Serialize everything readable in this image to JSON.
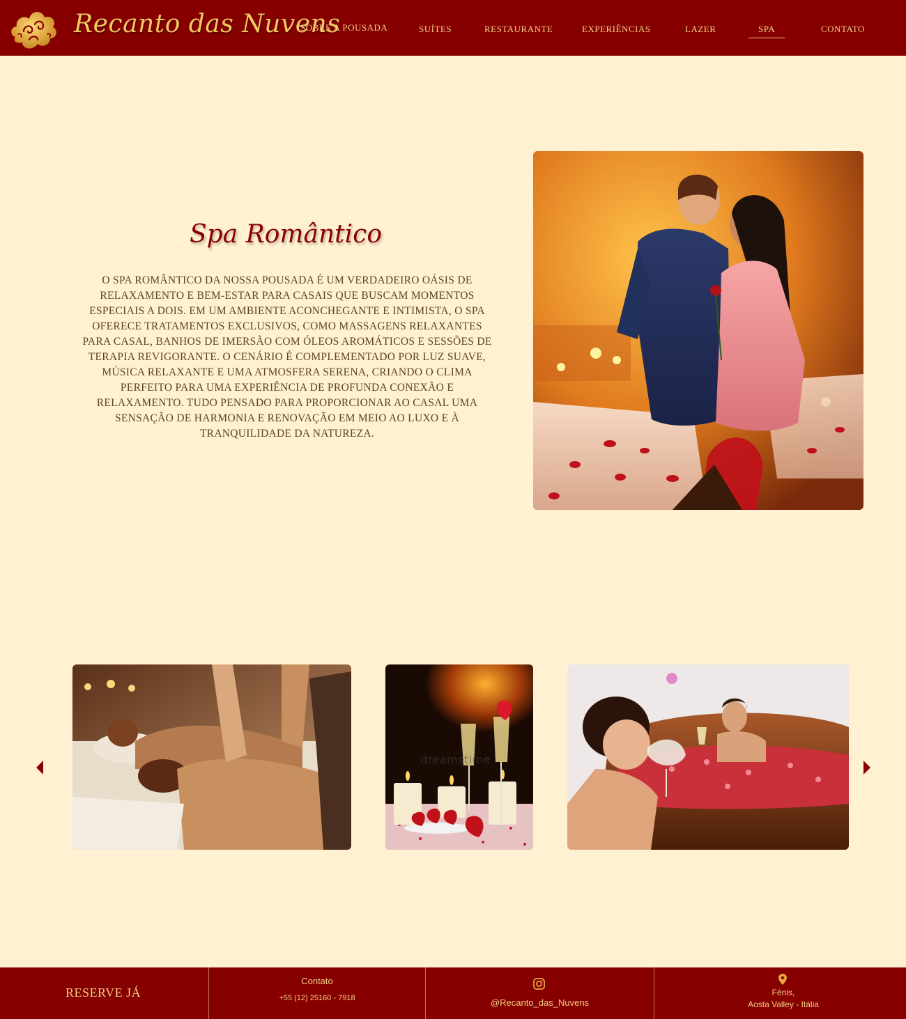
{
  "header": {
    "brand": "Recanto das Nuvens",
    "nav": [
      {
        "label": "SOBRE A POUSADA"
      },
      {
        "label": "SUÍTES"
      },
      {
        "label": "RESTAURANTE"
      },
      {
        "label": "EXPERIÊNCIAS"
      },
      {
        "label": "LAZER"
      },
      {
        "label": "SPA",
        "active": true
      },
      {
        "label": "CONTATO"
      }
    ]
  },
  "intro": {
    "title": "Spa Romântico",
    "text": "O spa romântico da nossa pousada é um verdadeiro oásis de relaxamento e bem-estar para casais que buscam momentos especiais a dois. Em um ambiente aconchegante e intimista, o spa oferece tratamentos exclusivos, como massagens relaxantes para casal, banhos de imersão com óleos aromáticos e sessões de terapia revigorante. O cenário é complementado por luz suave, música relaxante e uma atmosfera serena, criando o clima perfeito para uma experiência de profunda conexão e relaxamento. Tudo pensado para proporcionar ao casal uma sensação de harmonia e renovação em meio ao luxo e à tranquilidade da natureza."
  },
  "gallery": {
    "watermark": "dreamstime"
  },
  "footer": {
    "reserve": "RESERVE JÁ",
    "contact_title": "Contato",
    "phone": "+55 (12) 25160 - 7918",
    "instagram": "@Recanto_das_Nuvens",
    "location_line1": "Fénis,",
    "location_line2": "Aosta Valley -  Itália"
  },
  "colors": {
    "primary": "#860000",
    "background": "#fff1d2",
    "accent": "#f2cf86",
    "title": "#8a0000"
  }
}
